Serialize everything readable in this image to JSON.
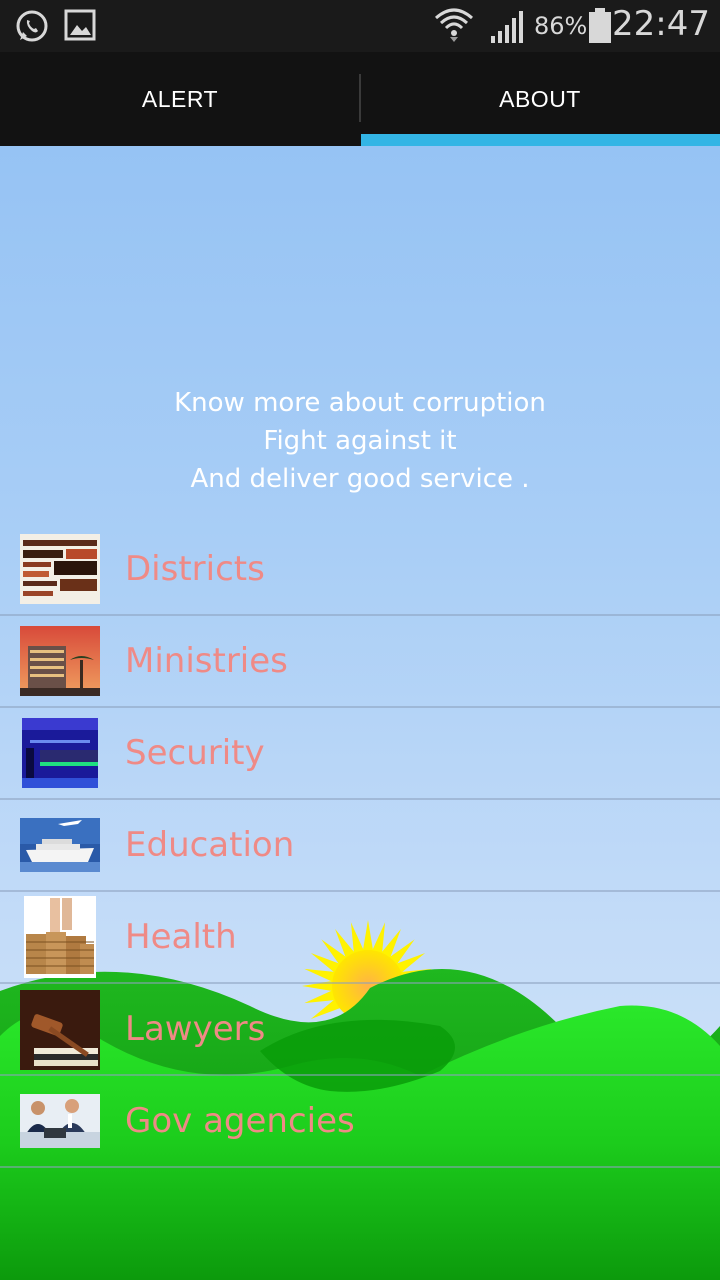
{
  "status_bar": {
    "icons": [
      "whatsapp-icon",
      "gallery-icon",
      "wifi-icon",
      "signal-icon",
      "battery-icon"
    ],
    "battery": "86%",
    "time": "22:47"
  },
  "tabs": [
    {
      "label": "ALERT",
      "selected": false
    },
    {
      "label": "ABOUT",
      "selected": true
    }
  ],
  "accent_color": "#33b5e5",
  "about": {
    "line1": "Know more about corruption",
    "line2": "Fight against it",
    "line3": "And deliver good service ."
  },
  "categories": [
    {
      "label": "Districts",
      "thumbnail": "word-cloud-image"
    },
    {
      "label": "Ministries",
      "thumbnail": "building-image"
    },
    {
      "label": "Security",
      "thumbnail": "bar-interior-image"
    },
    {
      "label": "Education",
      "thumbnail": "cruise-ship-image"
    },
    {
      "label": "Health",
      "thumbnail": "coin-stacks-image"
    },
    {
      "label": "Lawyers",
      "thumbnail": "gavel-image"
    },
    {
      "label": "Gov agencies",
      "thumbnail": "office-workers-image"
    }
  ],
  "label_color": "#ef8a86"
}
